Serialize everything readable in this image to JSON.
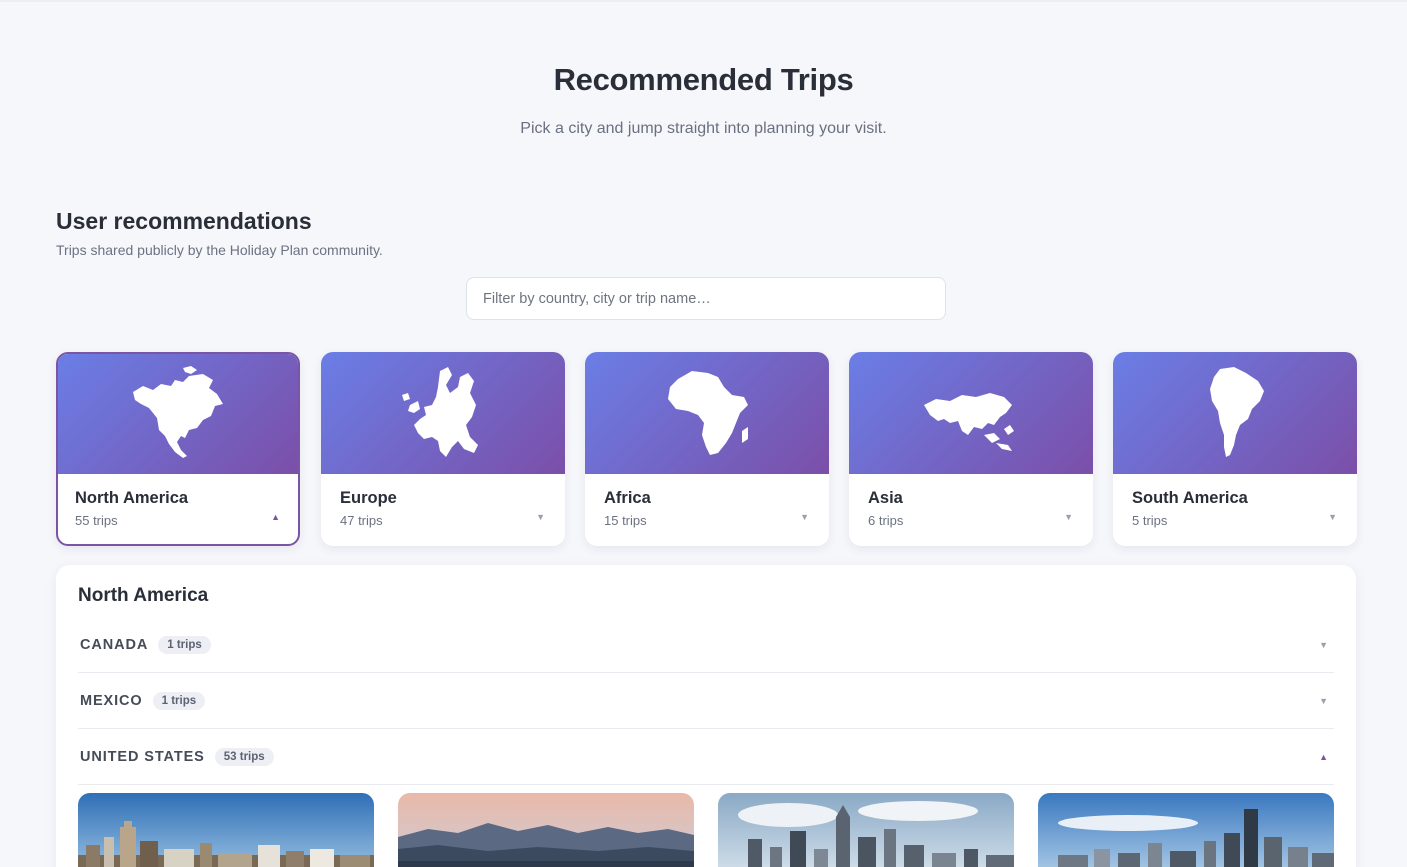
{
  "hero": {
    "title": "Recommended Trips",
    "subtitle": "Pick a city and jump straight into planning your visit."
  },
  "section": {
    "title": "User recommendations",
    "subtitle": "Trips shared publicly by the Holiday Plan community."
  },
  "search": {
    "placeholder": "Filter by country, city or trip name…"
  },
  "continents": [
    {
      "name": "North America",
      "count": "55 trips",
      "icon": "north-america-map",
      "expanded": true
    },
    {
      "name": "Europe",
      "count": "47 trips",
      "icon": "europe-map",
      "expanded": false
    },
    {
      "name": "Africa",
      "count": "15 trips",
      "icon": "africa-map",
      "expanded": false
    },
    {
      "name": "Asia",
      "count": "6 trips",
      "icon": "asia-map",
      "expanded": false
    },
    {
      "name": "South America",
      "count": "5 trips",
      "icon": "south-america-map",
      "expanded": false
    }
  ],
  "arrows": {
    "up": "▲",
    "down": "▼"
  },
  "panel": {
    "title": "North America",
    "countries": [
      {
        "name": "CANADA",
        "badge": "1 trips",
        "expanded": false
      },
      {
        "name": "MEXICO",
        "badge": "1 trips",
        "expanded": false
      },
      {
        "name": "UNITED STATES",
        "badge": "53 trips",
        "expanded": true
      }
    ]
  },
  "colors": {
    "accent": "#7a55a6",
    "gradient_start": "#6a7ee6",
    "gradient_end": "#7b4fa8",
    "background": "#f6f7fb"
  }
}
